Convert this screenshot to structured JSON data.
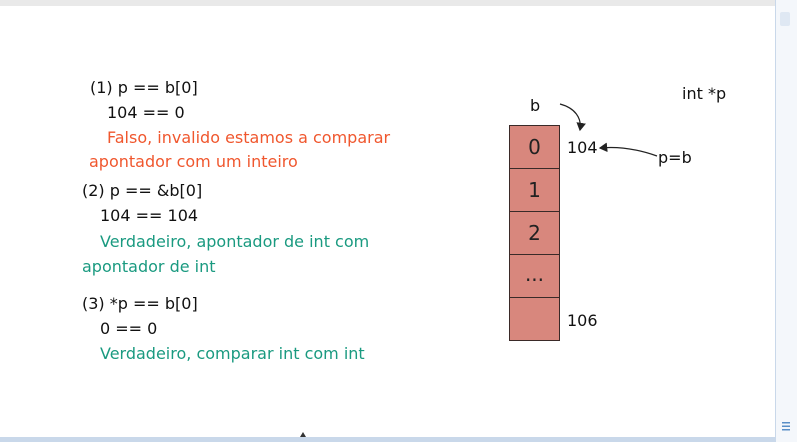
{
  "left": {
    "case1": {
      "title": "(1) p == b[0]",
      "eval": "104 == 0",
      "verdict_line1": "Falso, invalido estamos a comparar",
      "verdict_line2": "apontador com um inteiro"
    },
    "case2": {
      "title": "(2) p == &b[0]",
      "eval": "104 == 104",
      "verdict_line1": "Verdadeiro, apontador de int com",
      "verdict_line2": "apontador de int"
    },
    "case3": {
      "title": "(3) *p == b[0]",
      "eval": "0 == 0",
      "verdict_line1": "Verdadeiro, comparar int com int"
    }
  },
  "diagram": {
    "array_name": "b",
    "cells": [
      "0",
      "1",
      "2",
      "...",
      ""
    ],
    "address_first": "104",
    "address_last": "106",
    "pointer_label": "p=b",
    "declaration": "int *p"
  },
  "colors": {
    "false_text": "#f0572e",
    "true_text": "#1a9a80",
    "cell_fill": "#d8877d",
    "cell_border": "#3a2a28"
  }
}
